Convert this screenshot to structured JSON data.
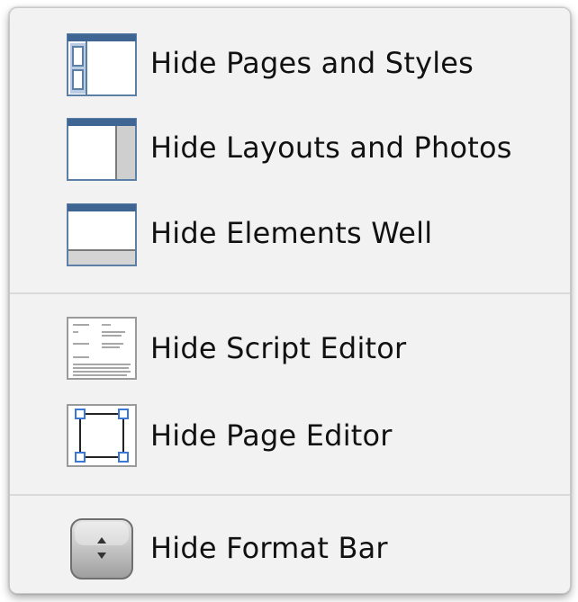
{
  "menu": {
    "items": [
      {
        "label": "Hide Pages and Styles",
        "icon": "pages-and-styles-panel-icon"
      },
      {
        "label": "Hide Layouts and Photos",
        "icon": "layouts-and-photos-panel-icon"
      },
      {
        "label": "Hide Elements Well",
        "icon": "elements-well-panel-icon"
      },
      {
        "label": "Hide Script Editor",
        "icon": "script-editor-icon"
      },
      {
        "label": "Hide Page Editor",
        "icon": "page-editor-icon"
      },
      {
        "label": "Hide Format Bar",
        "icon": "format-bar-stepper-icon"
      }
    ]
  }
}
